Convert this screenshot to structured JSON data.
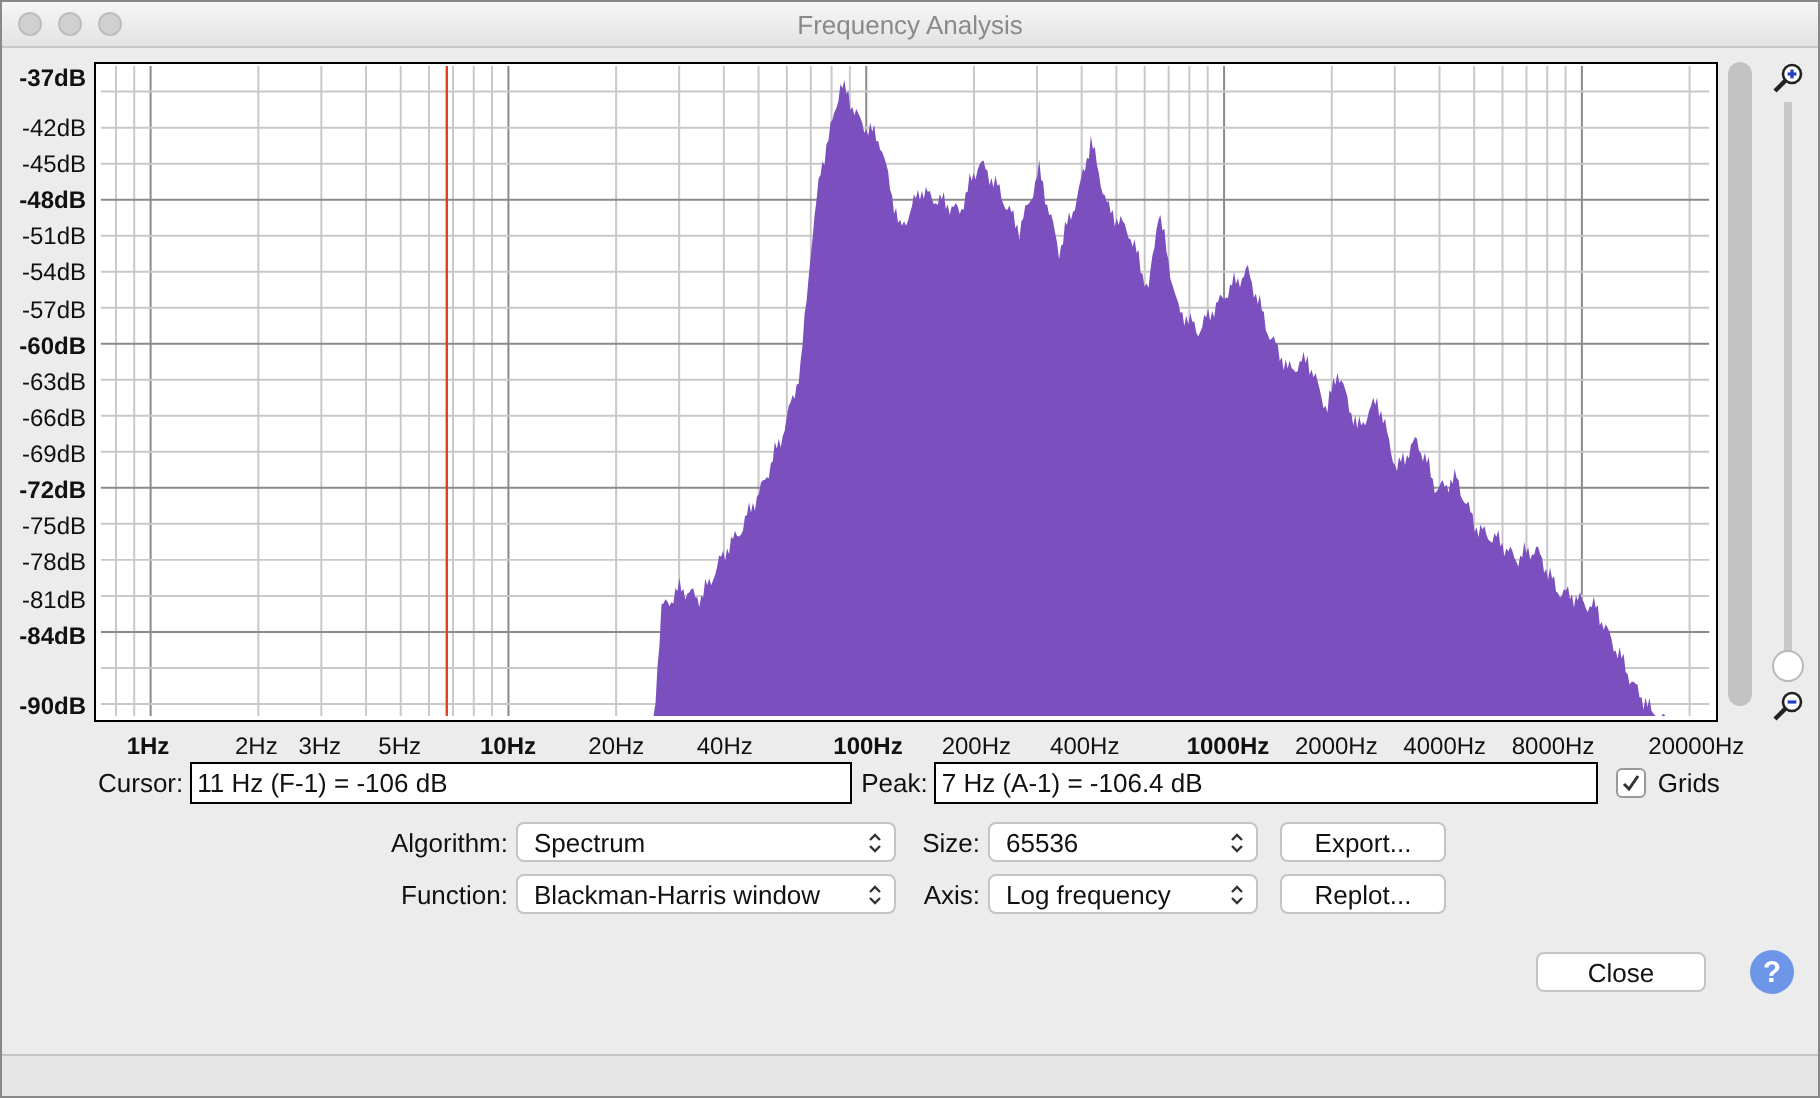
{
  "window": {
    "title": "Frequency Analysis"
  },
  "plot": {
    "y_labels": [
      {
        "text": "-37dB",
        "major": true
      },
      {
        "text": "-42dB",
        "major": false
      },
      {
        "text": "-45dB",
        "major": false
      },
      {
        "text": "-48dB",
        "major": true
      },
      {
        "text": "-51dB",
        "major": false
      },
      {
        "text": "-54dB",
        "major": false
      },
      {
        "text": "-57dB",
        "major": false
      },
      {
        "text": "-60dB",
        "major": true
      },
      {
        "text": "-63dB",
        "major": false
      },
      {
        "text": "-66dB",
        "major": false
      },
      {
        "text": "-69dB",
        "major": false
      },
      {
        "text": "-72dB",
        "major": true
      },
      {
        "text": "-75dB",
        "major": false
      },
      {
        "text": "-78dB",
        "major": false
      },
      {
        "text": "-81dB",
        "major": false
      },
      {
        "text": "-84dB",
        "major": true
      },
      {
        "text": "-90dB",
        "major": true
      }
    ],
    "x_labels": [
      {
        "text": "1Hz",
        "major": true
      },
      {
        "text": "2Hz",
        "major": false
      },
      {
        "text": "3Hz",
        "major": false
      },
      {
        "text": "5Hz",
        "major": false
      },
      {
        "text": "10Hz",
        "major": true
      },
      {
        "text": "20Hz",
        "major": false
      },
      {
        "text": "40Hz",
        "major": false
      },
      {
        "text": "100Hz",
        "major": true
      },
      {
        "text": "200Hz",
        "major": false
      },
      {
        "text": "400Hz",
        "major": false
      },
      {
        "text": "1000Hz",
        "major": true
      },
      {
        "text": "2000Hz",
        "major": false
      },
      {
        "text": "4000Hz",
        "major": false
      },
      {
        "text": "8000Hz",
        "major": false
      },
      {
        "text": "20000Hz",
        "major": false
      }
    ]
  },
  "zoom": {
    "level": 0
  },
  "cursor": {
    "label": "Cursor:",
    "value": "11 Hz (F-1) = -106 dB"
  },
  "peak": {
    "label": "Peak:",
    "value": "7 Hz (A-1) = -106.4 dB"
  },
  "grids": {
    "label": "Grids",
    "checked": true
  },
  "algorithm": {
    "label": "Algorithm:",
    "value": "Spectrum"
  },
  "size": {
    "label": "Size:",
    "value": "65536"
  },
  "function": {
    "label": "Function:",
    "value": "Blackman-Harris window"
  },
  "axis": {
    "label": "Axis:",
    "value": "Log frequency"
  },
  "buttons": [
    {
      "label": "Export..."
    },
    {
      "label": "Replot..."
    }
  ],
  "close": {
    "label": "Close"
  },
  "help": {
    "label": "?"
  }
}
